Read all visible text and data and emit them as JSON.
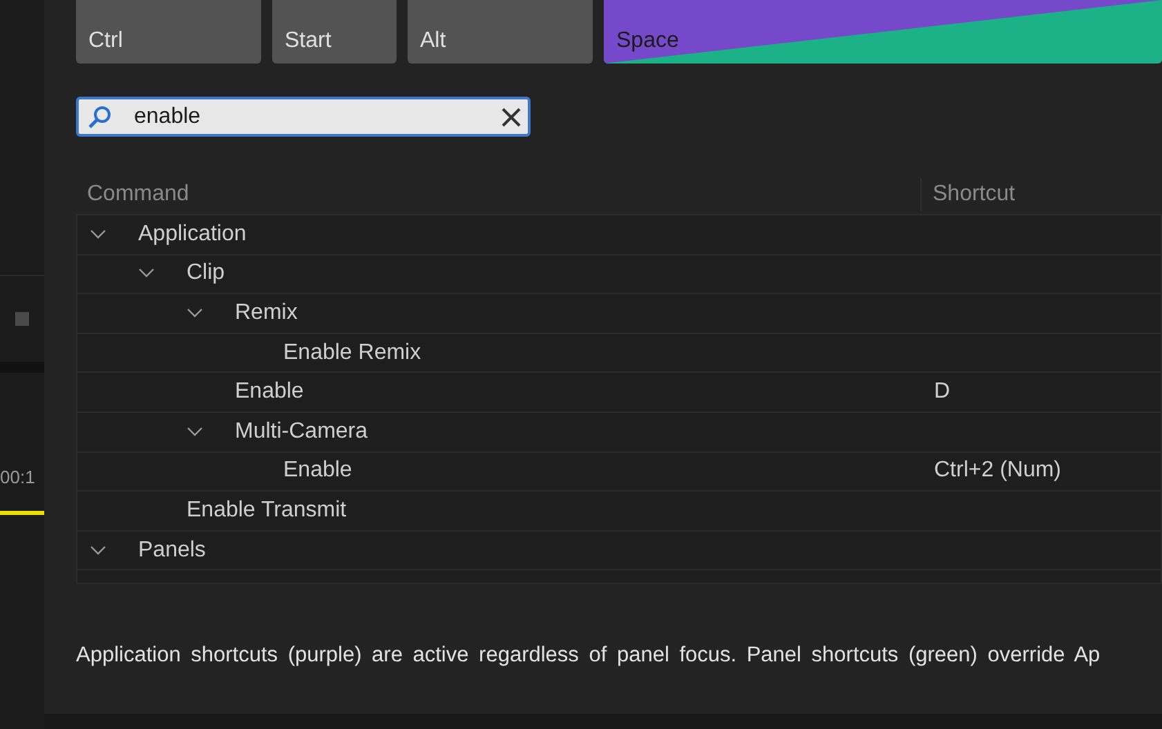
{
  "background_panel": {
    "timecode": "00:1"
  },
  "keys": [
    {
      "label": "Ctrl",
      "kind": "plain"
    },
    {
      "label": "Start",
      "kind": "plain"
    },
    {
      "label": "Alt",
      "kind": "plain"
    },
    {
      "label": "Space",
      "kind": "split"
    }
  ],
  "search": {
    "value": "enable"
  },
  "table": {
    "columns": [
      "Command",
      "Shortcut"
    ],
    "rows": [
      {
        "command": "Application",
        "expanded": true,
        "children": [
          {
            "command": "Clip",
            "expanded": true,
            "children": [
              {
                "command": "Remix",
                "expanded": true,
                "children": [
                  {
                    "command": "Enable Remix"
                  }
                ]
              },
              {
                "command": "Enable",
                "shortcut": "D"
              },
              {
                "command": "Multi-Camera",
                "expanded": true,
                "children": [
                  {
                    "command": "Enable",
                    "shortcut": "Ctrl+2 (Num)"
                  }
                ]
              }
            ]
          },
          {
            "command": "Enable Transmit"
          }
        ]
      },
      {
        "command": "Panels",
        "expanded": true
      }
    ]
  },
  "footer_note": "Application shortcuts (purple) are active regardless of panel focus. Panel shortcuts (green) override Ap"
}
